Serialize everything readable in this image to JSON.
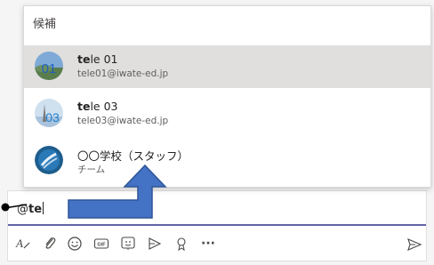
{
  "popup": {
    "title": "候補",
    "items": [
      {
        "name_bold": "te",
        "name_rest": "le 01",
        "email": "tele01@iwate-ed.jp",
        "avatar_text": "01",
        "selected": true
      },
      {
        "name_bold": "te",
        "name_rest": "le 03",
        "email": "tele03@iwate-ed.jp",
        "avatar_text": "03",
        "selected": false
      },
      {
        "name_bold": "",
        "name_rest": "〇〇学校（スタッフ）",
        "email": "チーム",
        "avatar_text": "",
        "selected": false
      }
    ]
  },
  "compose": {
    "prefix": "@",
    "typed_bold": "te"
  },
  "toolbar": {
    "icons": [
      "format-icon",
      "attach-icon",
      "emoji-icon",
      "gif-icon",
      "sticker-icon",
      "meet-now-icon",
      "praise-icon",
      "more-icon"
    ],
    "gif_label": "GIF",
    "more_label": "···"
  },
  "colors": {
    "accent": "#6264a7",
    "arrow_fill": "#4472c4",
    "arrow_stroke": "#2f5597"
  }
}
